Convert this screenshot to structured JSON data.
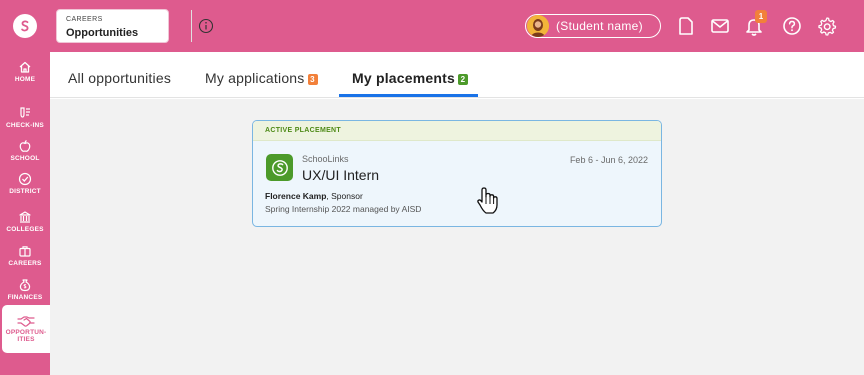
{
  "header": {
    "breadcrumb_small": "CAREERS",
    "breadcrumb_title": "Opportunities",
    "student_name": "(Student name)",
    "notification_count": "1",
    "icons": [
      "schoolinks-logo-icon",
      "info-icon",
      "document-icon",
      "mail-icon",
      "bell-icon",
      "help-icon",
      "gear-icon"
    ]
  },
  "sidebar": {
    "items": [
      {
        "label": "HOME",
        "icon": "home-icon"
      },
      {
        "label": "CHECK-INS",
        "icon": "check-ins-icon"
      },
      {
        "label": "SCHOOL",
        "icon": "apple-icon"
      },
      {
        "label": "DISTRICT",
        "icon": "district-icon"
      },
      {
        "label": "COLLEGES",
        "icon": "college-icon"
      },
      {
        "label": "CAREERS",
        "icon": "briefcase-icon"
      },
      {
        "label": "FINANCES",
        "icon": "money-bag-icon"
      },
      {
        "label": "OPPORTUN-\nITIES",
        "label_line1": "OPPORTUN-",
        "label_line2": "ITIES",
        "icon": "handshake-icon",
        "active": true
      }
    ]
  },
  "tabs": [
    {
      "label": "All opportunities",
      "count": null
    },
    {
      "label": "My applications",
      "count": "3",
      "count_color": "#f2803a"
    },
    {
      "label": "My placements",
      "count": "2",
      "count_color": "#4c9a2a",
      "active": true
    }
  ],
  "placement_card": {
    "status_label": "ACTIVE PLACEMENT",
    "organization": "SchooLinks",
    "title": "UX/UI Intern",
    "date_range": "Feb 6 - Jun 6, 2022",
    "sponsor_name": "Florence Kamp",
    "sponsor_role": ", Sponsor",
    "program": "Spring Internship 2022 managed by AISD"
  },
  "colors": {
    "brand_pink": "#de5b8e",
    "active_tab_underline": "#1a73e8",
    "active_status_green": "#4e8a17",
    "card_border": "#7ab6e2"
  }
}
